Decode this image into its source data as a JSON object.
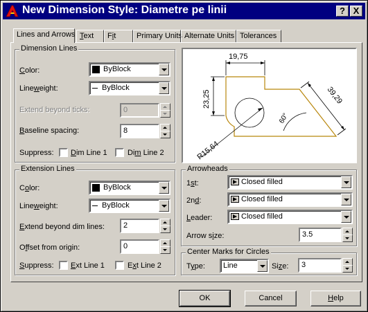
{
  "title": "New Dimension Style: Diametre pe linii",
  "titlebar_buttons": {
    "help": "?",
    "close": "X"
  },
  "tabs": [
    "Lines and Arrows",
    "Text",
    "Fit",
    "Primary Units",
    "Alternate Units",
    "Tolerances"
  ],
  "dimension_lines": {
    "title": "Dimension Lines",
    "color_label": "Color:",
    "color_value": "ByBlock",
    "lineweight_label": "Lineweight:",
    "lineweight_value": "ByBlock",
    "extend_label": "Extend beyond ticks:",
    "extend_value": "0",
    "baseline_label": "Baseline spacing:",
    "baseline_value": "8",
    "suppress_label": "Suppress:",
    "dim_line_1": "Dim Line 1",
    "dim_line_2": "Dim Line 2"
  },
  "extension_lines": {
    "title": "Extension Lines",
    "color_label": "Color:",
    "color_value": "ByBlock",
    "lineweight_label": "Lineweight:",
    "lineweight_value": "ByBlock",
    "extend_label": "Extend beyond dim lines:",
    "extend_value": "2",
    "offset_label": "Offset from origin:",
    "offset_value": "0",
    "suppress_label": "Suppress:",
    "ext_line_1": "Ext Line 1",
    "ext_line_2": "Ext Line 2"
  },
  "preview": {
    "dim_top": "19,75",
    "dim_left": "23,25",
    "dim_right": "39,29",
    "dim_angle": "60°",
    "dim_radius": "R15,64"
  },
  "arrowheads": {
    "title": "Arrowheads",
    "first_label": "1st:",
    "first_value": "Closed filled",
    "second_label": "2nd:",
    "second_value": "Closed filled",
    "leader_label": "Leader:",
    "leader_value": "Closed filled",
    "size_label": "Arrow size:",
    "size_value": "3.5"
  },
  "center_marks": {
    "title": "Center Marks for Circles",
    "type_label": "Type:",
    "type_value": "Line",
    "size_label": "Size:",
    "size_value": "3"
  },
  "buttons": {
    "ok": "OK",
    "cancel": "Cancel",
    "help": "Help"
  },
  "colors": {
    "titlebar": "#000080",
    "face": "#d4d0c8",
    "preview_geometry": "#b8860b"
  }
}
